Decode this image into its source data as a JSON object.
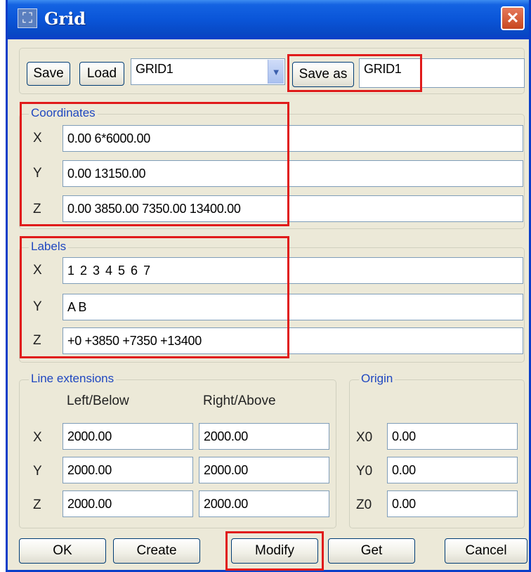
{
  "window": {
    "title": "Grid",
    "close_symbol": "✕"
  },
  "toolbar": {
    "save_label": "Save",
    "load_label": "Load",
    "grid_select_value": "GRID1",
    "save_as_label": "Save as",
    "save_as_value": "GRID1"
  },
  "coordinates": {
    "legend": "Coordinates",
    "x_label": "X",
    "x_value": "0.00 6*6000.00",
    "y_label": "Y",
    "y_value": "0.00 13150.00",
    "z_label": "Z",
    "z_value": "0.00 3850.00 7350.00 13400.00"
  },
  "labels": {
    "legend": "Labels",
    "x_label": "X",
    "x_value": "1 2 3 4 5 6 7",
    "y_label": "Y",
    "y_value": "A B",
    "z_label": "Z",
    "z_value": "+0 +3850 +7350 +13400"
  },
  "line_extensions": {
    "legend": "Line extensions",
    "left_below_header": "Left/Below",
    "right_above_header": "Right/Above",
    "rows": [
      {
        "axis": "X",
        "left": "2000.00",
        "right": "2000.00"
      },
      {
        "axis": "Y",
        "left": "2000.00",
        "right": "2000.00"
      },
      {
        "axis": "Z",
        "left": "2000.00",
        "right": "2000.00"
      }
    ]
  },
  "origin": {
    "legend": "Origin",
    "rows": [
      {
        "axis": "X0",
        "value": "0.00"
      },
      {
        "axis": "Y0",
        "value": "0.00"
      },
      {
        "axis": "Z0",
        "value": "0.00"
      }
    ]
  },
  "footer": {
    "ok_label": "OK",
    "create_label": "Create",
    "modify_label": "Modify",
    "get_label": "Get",
    "cancel_label": "Cancel"
  },
  "colors": {
    "highlight": "#e01b1b",
    "titlebar": "#0a55d8",
    "legend_text": "#1f47c0",
    "dialog_bg": "#ece9d8"
  }
}
